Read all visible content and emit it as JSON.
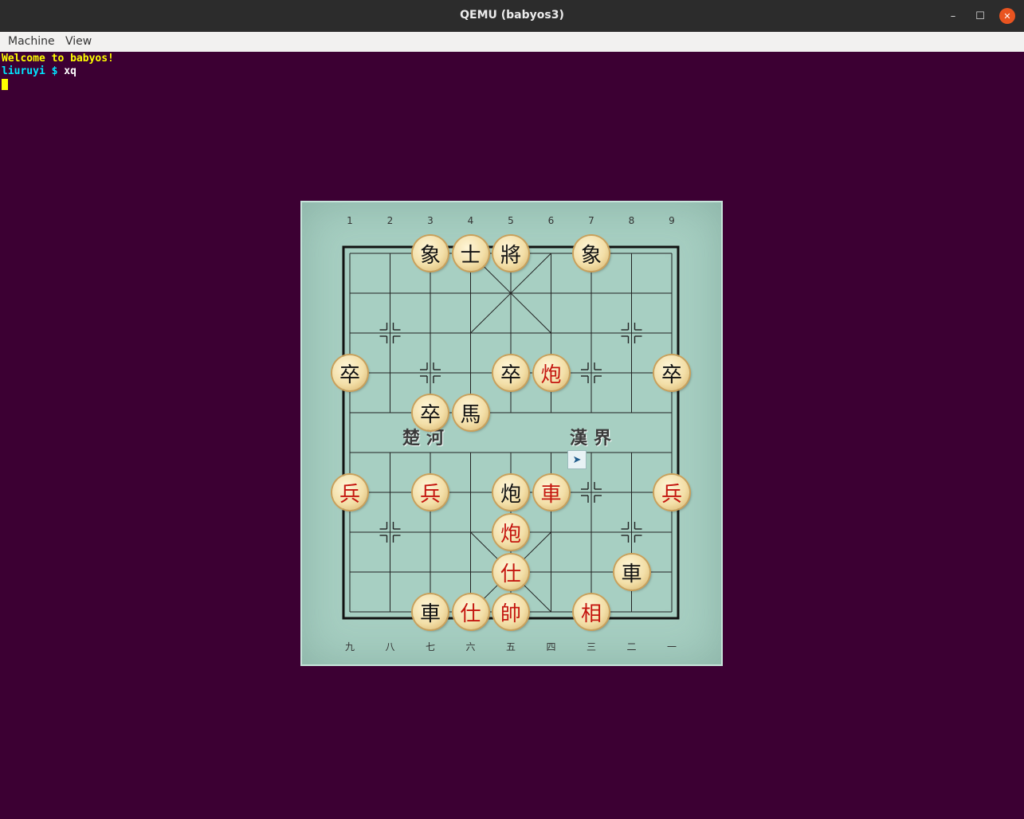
{
  "window": {
    "title": "QEMU (babyos3)",
    "buttons": {
      "minimize": "–",
      "maximize": "☐",
      "close": "✕"
    }
  },
  "menubar": {
    "items": [
      "Machine",
      "View"
    ]
  },
  "console": {
    "lines": [
      {
        "text": "Welcome to babyos!",
        "color": "#ffff00"
      },
      {
        "text": "liuruyi $ ",
        "color": "#00e5ff",
        "cmd": "xq",
        "cmd_color": "#ffffff"
      }
    ],
    "cursor_color": "#ffff00",
    "background": "#3c0033"
  },
  "board": {
    "top_numbers": [
      "1",
      "2",
      "3",
      "4",
      "5",
      "6",
      "7",
      "8",
      "9"
    ],
    "bottom_numbers": [
      "九",
      "八",
      "七",
      "六",
      "五",
      "四",
      "三",
      "二",
      "一"
    ],
    "river_left": "楚河",
    "river_right": "漢界",
    "pieces": [
      {
        "char": "象",
        "side": "black",
        "col": 2,
        "row": 0
      },
      {
        "char": "士",
        "side": "black",
        "col": 3,
        "row": 0
      },
      {
        "char": "將",
        "side": "black",
        "col": 4,
        "row": 0
      },
      {
        "char": "象",
        "side": "black",
        "col": 6,
        "row": 0
      },
      {
        "char": "卒",
        "side": "black",
        "col": 0,
        "row": 3
      },
      {
        "char": "卒",
        "side": "black",
        "col": 4,
        "row": 3
      },
      {
        "char": "炮",
        "side": "red",
        "col": 5,
        "row": 3
      },
      {
        "char": "卒",
        "side": "black",
        "col": 8,
        "row": 3
      },
      {
        "char": "卒",
        "side": "black",
        "col": 2,
        "row": 4
      },
      {
        "char": "馬",
        "side": "black",
        "col": 3,
        "row": 4
      },
      {
        "char": "兵",
        "side": "red",
        "col": 0,
        "row": 6
      },
      {
        "char": "兵",
        "side": "red",
        "col": 2,
        "row": 6
      },
      {
        "char": "炮",
        "side": "black",
        "col": 4,
        "row": 6
      },
      {
        "char": "車",
        "side": "red",
        "col": 5,
        "row": 6
      },
      {
        "char": "兵",
        "side": "red",
        "col": 8,
        "row": 6
      },
      {
        "char": "炮",
        "side": "red",
        "col": 4,
        "row": 7
      },
      {
        "char": "仕",
        "side": "red",
        "col": 4,
        "row": 8
      },
      {
        "char": "車",
        "side": "black",
        "col": 7,
        "row": 8
      },
      {
        "char": "車",
        "side": "black",
        "col": 2,
        "row": 9
      },
      {
        "char": "仕",
        "side": "red",
        "col": 3,
        "row": 9
      },
      {
        "char": "帥",
        "side": "red",
        "col": 4,
        "row": 9
      },
      {
        "char": "相",
        "side": "red",
        "col": 6,
        "row": 9
      }
    ],
    "mouse_icon": "mouse-pointer-icon"
  }
}
